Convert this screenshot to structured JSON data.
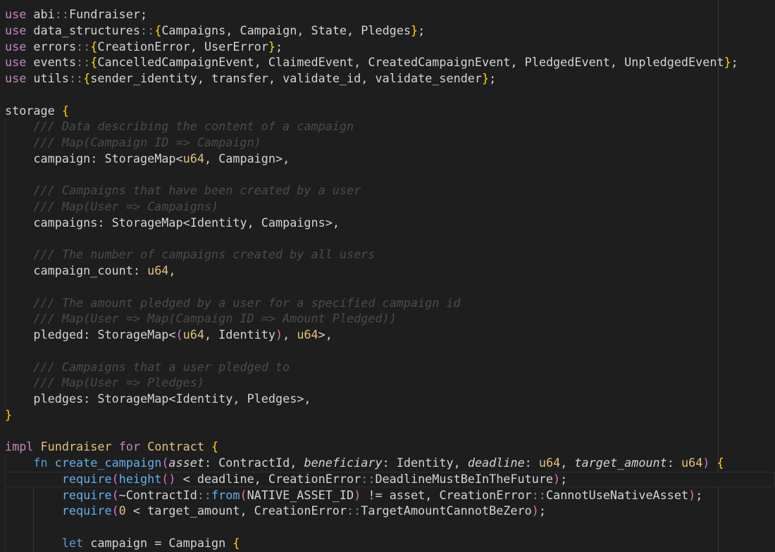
{
  "editor": {
    "lines": [
      "use abi::Fundraiser;",
      "use data_structures::{Campaigns, Campaign, State, Pledges};",
      "use errors::{CreationError, UserError};",
      "use events::{CancelledCampaignEvent, ClaimedEvent, CreatedCampaignEvent, PledgedEvent, UnpledgedEvent};",
      "use utils::{sender_identity, transfer, validate_id, validate_sender};",
      "",
      "storage {",
      "    /// Data describing the content of a campaign",
      "    /// Map(Campaign ID => Campaign)",
      "    campaign: StorageMap<u64, Campaign>,",
      "",
      "    /// Campaigns that have been created by a user",
      "    /// Map(User => Campaigns)",
      "    campaigns: StorageMap<Identity, Campaigns>,",
      "",
      "    /// The number of campaigns created by all users",
      "    campaign_count: u64,",
      "",
      "    /// The amount pledged by a user for a specified campaign id",
      "    /// Map(User => Map(Campaign ID => Amount Pledged))",
      "    pledged: StorageMap<(u64, Identity), u64>,",
      "",
      "    /// Campaigns that a user pledged to",
      "    /// Map(User => Pledges)",
      "    pledges: StorageMap<Identity, Pledges>,",
      "}",
      "",
      "impl Fundraiser for Contract {",
      "    fn create_campaign(asset: ContractId, beneficiary: Identity, deadline: u64, target_amount: u64) {",
      "        require(height() < deadline, CreationError::DeadlineMustBeInTheFuture);",
      "        require(~ContractId::from(NATIVE_ASSET_ID) != asset, CreationError::CannotUseNativeAsset);",
      "        require(0 < target_amount, CreationError::TargetAmountCannotBeZero);",
      "",
      "        let campaign = Campaign {"
    ]
  }
}
